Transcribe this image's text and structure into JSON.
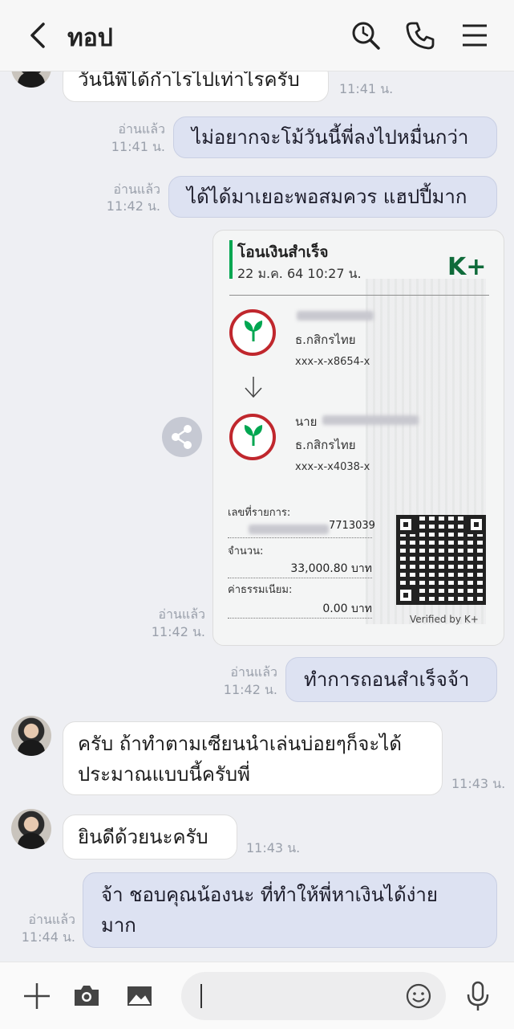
{
  "header": {
    "title": "ทอป"
  },
  "messages": {
    "m0": {
      "text": "วันนี้พี่ได้กำไรไปเท่าไรครับ",
      "time": "11:41 น."
    },
    "m1": {
      "text": "ไม่อยากจะโม้วันนี้พี่ลงไปหมื่นกว่า",
      "read": "อ่านแล้ว",
      "time": "11:41 น."
    },
    "m2": {
      "text": "ได้ได้มาเยอะพอสมควร แฮปปี้มาก",
      "read": "อ่านแล้ว",
      "time": "11:42 น."
    },
    "slip_meta": {
      "read": "อ่านแล้ว",
      "time": "11:42 น."
    },
    "m3": {
      "text": "ทำการถอนสำเร็จจ้า",
      "read": "อ่านแล้ว",
      "time": "11:42 น."
    },
    "m4": {
      "line1": "ครับ ถ้าทำตามเซียนนำเล่นบ่อยๆก็จะได้",
      "line2": "ประมาณแบบนี้ครับพี่",
      "time": "11:43 น."
    },
    "m5": {
      "text": "ยินดีด้วยนะครับ",
      "time": "11:43 น."
    },
    "m6": {
      "line1": "จ้า ชอบคุณน้องนะ ที่ทำให้พี่หาเงินได้ง่าย",
      "line2": "มาก",
      "read": "อ่านแล้ว",
      "time": "11:44 น."
    }
  },
  "slip": {
    "title": "โอนเงินสำเร็จ",
    "date": "22 ม.ค. 64  10:27 น.",
    "brand": "K+",
    "from_bank": "ธ.กสิกรไทย",
    "from_account": "xxx-x-x8654-x",
    "to_prefix": "นาย",
    "to_bank": "ธ.กสิกรไทย",
    "to_account": "xxx-x-x4038-x",
    "ref_label": "เลขที่รายการ:",
    "ref_value": "7713039",
    "amount_label": "จำนวน:",
    "amount_value": "33,000.80 บาท",
    "fee_label": "ค่าธรรมเนียม:",
    "fee_value": "0.00 บาท",
    "verified": "Verified by K+"
  },
  "colors": {
    "outgoing_bubble": "#dde2f2",
    "incoming_bubble": "#ffffff",
    "chat_background": "#eeeff3",
    "kbank_red": "#c0272d",
    "kbank_green": "#00a651"
  },
  "icons": [
    "back-arrow-icon",
    "search-icon",
    "phone-icon",
    "menu-icon",
    "share-icon",
    "plus-icon",
    "camera-icon",
    "image-icon",
    "emoji-icon",
    "microphone-icon"
  ]
}
